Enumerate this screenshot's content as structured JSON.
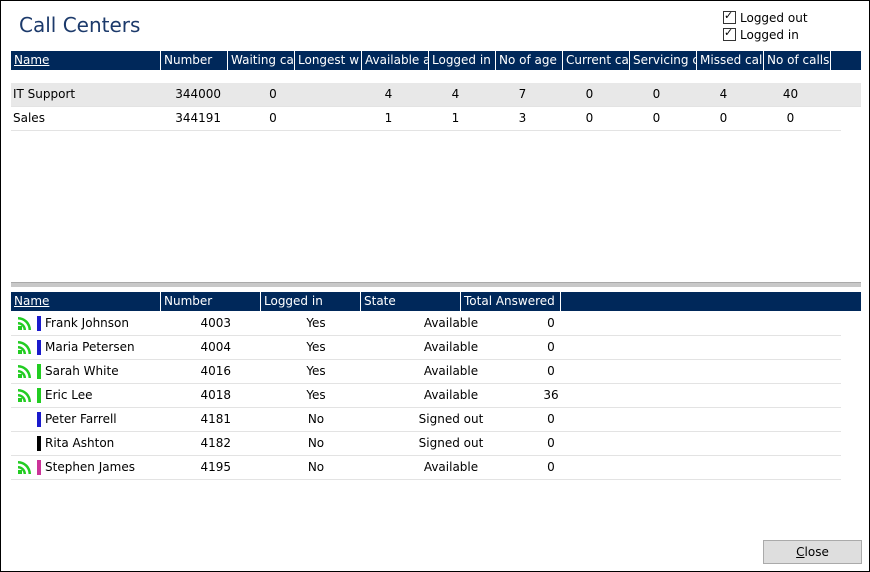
{
  "window": {
    "title": "Call Centers"
  },
  "filters": [
    {
      "label": "Logged out",
      "checked": true
    },
    {
      "label": "Logged in",
      "checked": true
    }
  ],
  "centers": {
    "columns": [
      "Name",
      "Number",
      "Waiting ca",
      "Longest w",
      "Available a",
      "Logged in",
      "No of age",
      "Current ca",
      "Servicing c",
      "Missed cal",
      "No of calls"
    ],
    "rows": [
      {
        "name": "IT Support",
        "number": "344000",
        "waiting": "0",
        "longest": "",
        "available": "4",
        "logged_in": "4",
        "no_agents": "7",
        "current": "0",
        "servicing": "0",
        "missed": "4",
        "calls": "40"
      },
      {
        "name": "Sales",
        "number": "344191",
        "waiting": "0",
        "longest": "",
        "available": "1",
        "logged_in": "1",
        "no_agents": "3",
        "current": "0",
        "servicing": "0",
        "missed": "0",
        "calls": "0"
      }
    ]
  },
  "agents": {
    "columns": [
      "Name",
      "Number",
      "Logged in",
      "State",
      "Total Answered"
    ],
    "rows": [
      {
        "name": "Frank Johnson",
        "number": "4003",
        "logged_in": "Yes",
        "state": "Available",
        "answered": "0",
        "signal_icon": "signal-icon",
        "color": "#1a1acc"
      },
      {
        "name": "Maria Petersen",
        "number": "4004",
        "logged_in": "Yes",
        "state": "Available",
        "answered": "0",
        "signal_icon": "signal-icon",
        "color": "#1a1acc"
      },
      {
        "name": "Sarah White",
        "number": "4016",
        "logged_in": "Yes",
        "state": "Available",
        "answered": "0",
        "signal_icon": "signal-icon",
        "color": "#22cc22"
      },
      {
        "name": "Eric Lee",
        "number": "4018",
        "logged_in": "Yes",
        "state": "Available",
        "answered": "36",
        "signal_icon": "signal-icon",
        "color": "#22cc22"
      },
      {
        "name": "Peter Farrell",
        "number": "4181",
        "logged_in": "No",
        "state": "Signed out",
        "answered": "0",
        "signal_icon": "",
        "color": "#1a1acc"
      },
      {
        "name": "Rita Ashton",
        "number": "4182",
        "logged_in": "No",
        "state": "Signed out",
        "answered": "0",
        "signal_icon": "",
        "color": "#000000"
      },
      {
        "name": "Stephen James",
        "number": "4195",
        "logged_in": "No",
        "state": "Available",
        "answered": "0",
        "signal_icon": "signal-icon",
        "color": "#cc3399"
      }
    ]
  },
  "footer": {
    "close_label": "Close"
  },
  "colors": {
    "header_bg": "#00285a",
    "title": "#1c3a6b",
    "signal": "#22cc22"
  }
}
